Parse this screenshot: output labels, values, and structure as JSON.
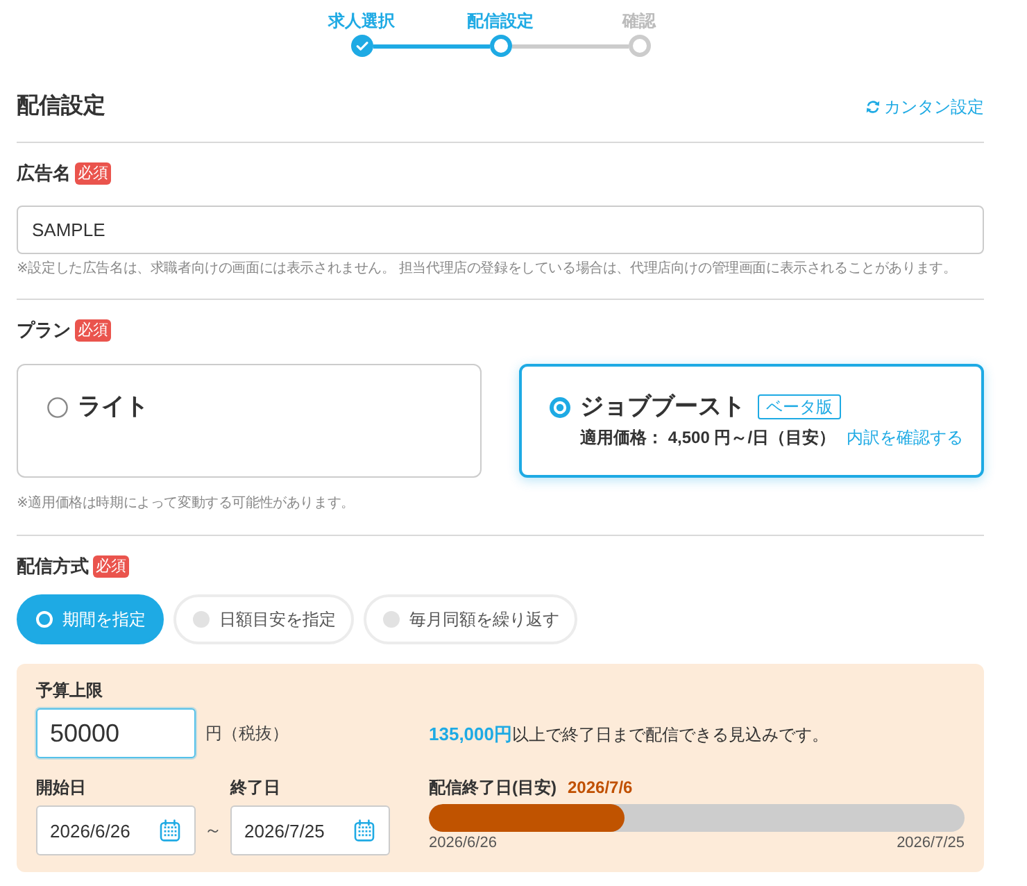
{
  "stepper": {
    "steps": [
      {
        "label": "求人選択",
        "done": true,
        "current": false
      },
      {
        "label": "配信設定",
        "done": false,
        "current": true
      },
      {
        "label": "確認",
        "done": false,
        "current": false
      }
    ]
  },
  "header": {
    "title": "配信設定",
    "quick_setup_link": "カンタン設定"
  },
  "ad_name": {
    "label": "広告名",
    "badge": "必須",
    "value": "SAMPLE",
    "note": "※設定した広告名は、求職者向けの画面には表示されません。 担当代理店の登録をしている場合は、代理店向けの管理画面に表示されることがあります。"
  },
  "plan": {
    "label": "プラン",
    "badge": "必須",
    "options": [
      {
        "name": "ライト",
        "selected": false
      },
      {
        "name": "ジョブブースト",
        "selected": true,
        "tag": "ベータ版",
        "price": "適用価格： 4,500 円～/日（目安）",
        "link": "内訳を確認する"
      }
    ],
    "note": "※適用価格は時期によって変動する可能性があります。"
  },
  "delivery_method": {
    "label": "配信方式",
    "badge": "必須",
    "options": [
      {
        "label": "期間を指定",
        "selected": true
      },
      {
        "label": "日額目安を指定",
        "selected": false
      },
      {
        "label": "毎月同額を繰り返す",
        "selected": false
      }
    ]
  },
  "period_settings": {
    "budget": {
      "label": "予算上限",
      "value": "50000",
      "focused": true,
      "unit": "円（税抜）"
    },
    "estimate": "**135,000円**以上で終了日まで配信できる見込みです。",
    "start_date": {
      "label": "開始日",
      "value": "2026/6/26"
    },
    "range_separator": "～",
    "end_date": {
      "label": "終了日",
      "value": "2026/7/25"
    },
    "end_forecast": {
      "label": "配信終了日(目安)",
      "value": "2026/7/6",
      "level": 0.365,
      "range_start": "2026/6/26",
      "range_end": "2026/7/25"
    }
  }
}
